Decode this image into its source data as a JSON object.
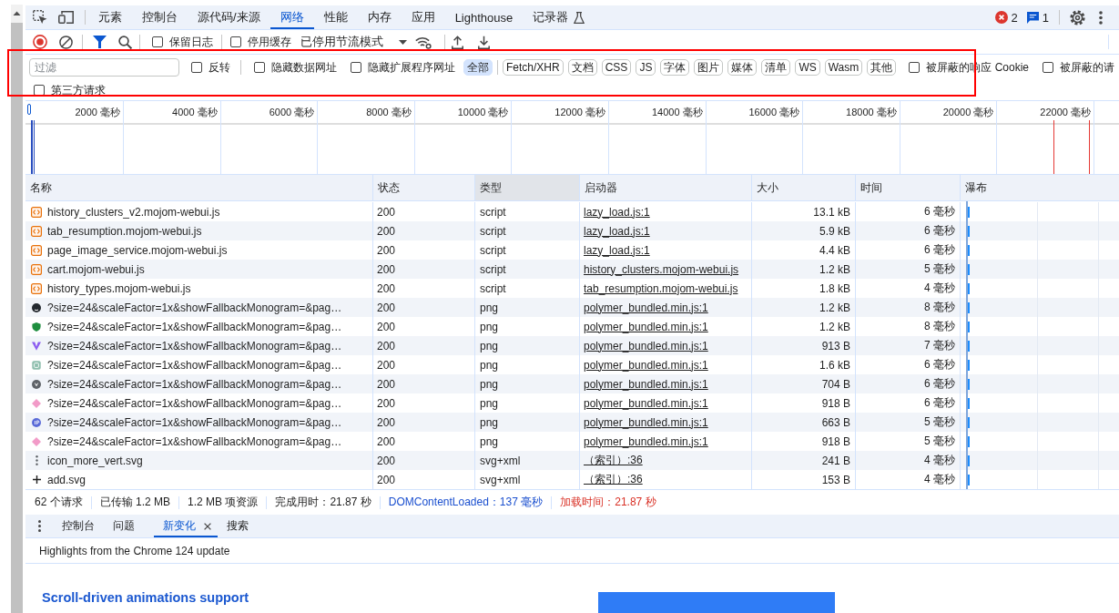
{
  "main_tabs": [
    {
      "label": "元素",
      "selected": false,
      "experimental": false
    },
    {
      "label": "控制台",
      "selected": false,
      "experimental": false
    },
    {
      "label": "源代码/来源",
      "selected": false,
      "experimental": false
    },
    {
      "label": "网络",
      "selected": true,
      "experimental": false
    },
    {
      "label": "性能",
      "selected": false,
      "experimental": false
    },
    {
      "label": "内存",
      "selected": false,
      "experimental": false
    },
    {
      "label": "应用",
      "selected": false,
      "experimental": false
    },
    {
      "label": "Lighthouse",
      "selected": false,
      "experimental": false
    },
    {
      "label": "记录器",
      "selected": false,
      "experimental": true
    }
  ],
  "issue_counts": {
    "errors": "2",
    "messages": "1"
  },
  "toolbar": {
    "recording": true,
    "filter_shown": true,
    "checkboxes": [
      {
        "label": "保留日志",
        "checked": false
      },
      {
        "label": "停用缓存",
        "checked": false
      }
    ],
    "throttling": "已停用节流模式"
  },
  "filter_bar": {
    "placeholder": "过滤",
    "invert": {
      "label": "反转",
      "checked": false
    },
    "hide_options": [
      {
        "label": "隐藏数据网址",
        "checked": false
      },
      {
        "label": "隐藏扩展程序网址",
        "checked": false
      }
    ],
    "types": [
      {
        "label": "全部",
        "selected": true
      },
      {
        "label": "Fetch/XHR",
        "selected": false
      },
      {
        "label": "文档",
        "selected": false
      },
      {
        "label": "CSS",
        "selected": false
      },
      {
        "label": "JS",
        "selected": false
      },
      {
        "label": "字体",
        "selected": false
      },
      {
        "label": "图片",
        "selected": false
      },
      {
        "label": "媒体",
        "selected": false
      },
      {
        "label": "清单",
        "selected": false
      },
      {
        "label": "WS",
        "selected": false
      },
      {
        "label": "Wasm",
        "selected": false
      },
      {
        "label": "其他",
        "selected": false
      }
    ],
    "blocked_options": [
      {
        "label": "被屏蔽的响应 Cookie",
        "checked": false
      },
      {
        "label": "被屏蔽的请",
        "checked": false
      }
    ],
    "third_party": {
      "label": "第三方请求",
      "checked": false
    }
  },
  "overview": {
    "ticks": [
      "2000 毫秒",
      "4000 毫秒",
      "6000 毫秒",
      "8000 毫秒",
      "10000 毫秒",
      "12000 毫秒",
      "14000 毫秒",
      "16000 毫秒",
      "18000 毫秒",
      "20000 毫秒",
      "22000 毫秒"
    ]
  },
  "table": {
    "columns": [
      {
        "label": "名称",
        "hovered": false
      },
      {
        "label": "状态",
        "hovered": false
      },
      {
        "label": "类型",
        "hovered": true
      },
      {
        "label": "启动器",
        "hovered": false
      },
      {
        "label": "大小",
        "hovered": false
      },
      {
        "label": "时间",
        "hovered": false
      },
      {
        "label": "瀑布",
        "hovered": false
      }
    ],
    "rows": [
      {
        "kind": "script",
        "name": "history_clusters_v2.mojom-webui.js",
        "status": "200",
        "type": "script",
        "initiator": "lazy_load.js:1",
        "size": "13.1 kB",
        "time": "6 毫秒"
      },
      {
        "kind": "script",
        "name": "tab_resumption.mojom-webui.js",
        "status": "200",
        "type": "script",
        "initiator": "lazy_load.js:1",
        "size": "5.9 kB",
        "time": "6 毫秒"
      },
      {
        "kind": "script",
        "name": "page_image_service.mojom-webui.js",
        "status": "200",
        "type": "script",
        "initiator": "lazy_load.js:1",
        "size": "4.4 kB",
        "time": "6 毫秒"
      },
      {
        "kind": "script",
        "name": "cart.mojom-webui.js",
        "status": "200",
        "type": "script",
        "initiator": "history_clusters.mojom-webui.js",
        "size": "1.2 kB",
        "time": "5 毫秒"
      },
      {
        "kind": "script",
        "name": "history_types.mojom-webui.js",
        "status": "200",
        "type": "script",
        "initiator": "tab_resumption.mojom-webui.js",
        "size": "1.8 kB",
        "time": "4 毫秒"
      },
      {
        "kind": "favicon",
        "color": "#24292f",
        "name": "?size=24&scaleFactor=1x&showFallbackMonogram=&pag…",
        "status": "200",
        "type": "png",
        "initiator": "polymer_bundled.min.js:1",
        "size": "1.2 kB",
        "time": "8 毫秒"
      },
      {
        "kind": "favicon",
        "color": "#1e8e3e",
        "name": "?size=24&scaleFactor=1x&showFallbackMonogram=&pag…",
        "status": "200",
        "type": "png",
        "initiator": "polymer_bundled.min.js:1",
        "size": "1.2 kB",
        "time": "8 毫秒"
      },
      {
        "kind": "favicon",
        "color": "#8c5cf0",
        "name": "?size=24&scaleFactor=1x&showFallbackMonogram=&pag…",
        "status": "200",
        "type": "png",
        "initiator": "polymer_bundled.min.js:1",
        "size": "913 B",
        "time": "7 毫秒"
      },
      {
        "kind": "favicon",
        "color": "#8fbfae",
        "name": "?size=24&scaleFactor=1x&showFallbackMonogram=&pag…",
        "status": "200",
        "type": "png",
        "initiator": "polymer_bundled.min.js:1",
        "size": "1.6 kB",
        "time": "6 毫秒"
      },
      {
        "kind": "favicon",
        "color": "#5f6368",
        "name": "?size=24&scaleFactor=1x&showFallbackMonogram=&pag…",
        "status": "200",
        "type": "png",
        "initiator": "polymer_bundled.min.js:1",
        "size": "704 B",
        "time": "6 毫秒"
      },
      {
        "kind": "favicon",
        "color": "#f29bc8",
        "name": "?size=24&scaleFactor=1x&showFallbackMonogram=&pag…",
        "status": "200",
        "type": "png",
        "initiator": "polymer_bundled.min.js:1",
        "size": "918 B",
        "time": "6 毫秒"
      },
      {
        "kind": "favicon",
        "color": "#5b6bd8",
        "name": "?size=24&scaleFactor=1x&showFallbackMonogram=&pag…",
        "status": "200",
        "type": "png",
        "initiator": "polymer_bundled.min.js:1",
        "size": "663 B",
        "time": "5 毫秒"
      },
      {
        "kind": "favicon",
        "color": "#f29bc8",
        "name": "?size=24&scaleFactor=1x&showFallbackMonogram=&pag…",
        "status": "200",
        "type": "png",
        "initiator": "polymer_bundled.min.js:1",
        "size": "918 B",
        "time": "5 毫秒"
      },
      {
        "kind": "svg",
        "name": "icon_more_vert.svg",
        "status": "200",
        "type": "svg+xml",
        "initiator": "（索引）:36",
        "size": "241 B",
        "time": "4 毫秒"
      },
      {
        "kind": "svg",
        "name": "add.svg",
        "status": "200",
        "type": "svg+xml",
        "initiator": "（索引）:36",
        "size": "153 B",
        "time": "4 毫秒"
      }
    ]
  },
  "status_bar": [
    {
      "text": "62 个请求",
      "kind": "summary"
    },
    {
      "text": "已传输 1.2 MB",
      "kind": "summary"
    },
    {
      "text": "1.2 MB 项资源",
      "kind": "summary"
    },
    {
      "text": "完成用时：21.87 秒",
      "kind": "summary"
    },
    {
      "text": "DOMContentLoaded：137 毫秒",
      "kind": "domcontentloaded"
    },
    {
      "text": "加载时间：21.87 秒",
      "kind": "load"
    }
  ],
  "drawer": {
    "tabs": [
      {
        "label": "控制台",
        "selected": false,
        "closable": false
      },
      {
        "label": "问题",
        "selected": false,
        "closable": false
      },
      {
        "label": "新变化",
        "selected": true,
        "closable": true
      },
      {
        "label": "搜索",
        "selected": false,
        "closable": false
      }
    ],
    "banner": "Highlights from the Chrome 124 update",
    "heading": "Scroll-driven animations support"
  }
}
